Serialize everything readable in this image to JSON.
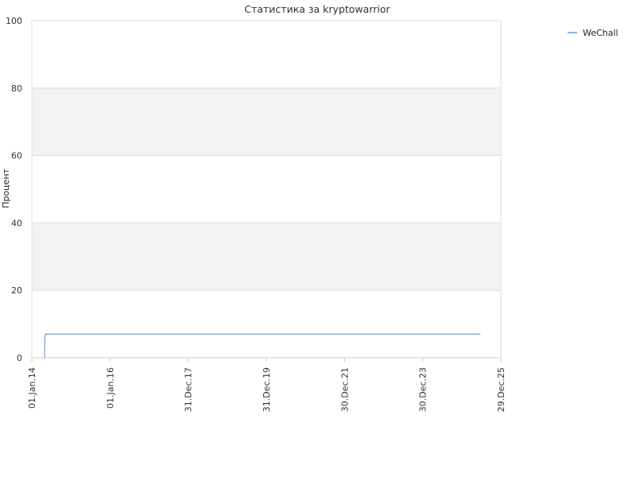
{
  "chart_data": {
    "type": "line",
    "title": "Статистика за kryptowarrior",
    "ylabel": "Процент",
    "xlabel": "",
    "ylim": [
      0,
      100
    ],
    "yticks": [
      0,
      20,
      40,
      60,
      80,
      100
    ],
    "xlim": [
      "2014-01-01",
      "2025-12-29"
    ],
    "xticks": [
      {
        "date": "2014-01-01",
        "label": "01.Jan.14"
      },
      {
        "date": "2016-01-01",
        "label": "01.Jan.16"
      },
      {
        "date": "2017-12-31",
        "label": "31.Dec.17"
      },
      {
        "date": "2019-12-31",
        "label": "31.Dec.19"
      },
      {
        "date": "2021-12-30",
        "label": "30.Dec.21"
      },
      {
        "date": "2023-12-30",
        "label": "30.Dec.23"
      },
      {
        "date": "2025-12-29",
        "label": "29.Dec.25"
      }
    ],
    "grid": true,
    "alternating_bands": true,
    "legend_position": "top-right",
    "series": [
      {
        "name": "WeChall",
        "color": "#7cb5ec",
        "points": [
          {
            "x": "2014-05-01",
            "y": 0
          },
          {
            "x": "2014-05-03",
            "y": 6
          },
          {
            "x": "2014-05-10",
            "y": 7
          },
          {
            "x": "2025-06-15",
            "y": 7
          }
        ]
      }
    ]
  }
}
